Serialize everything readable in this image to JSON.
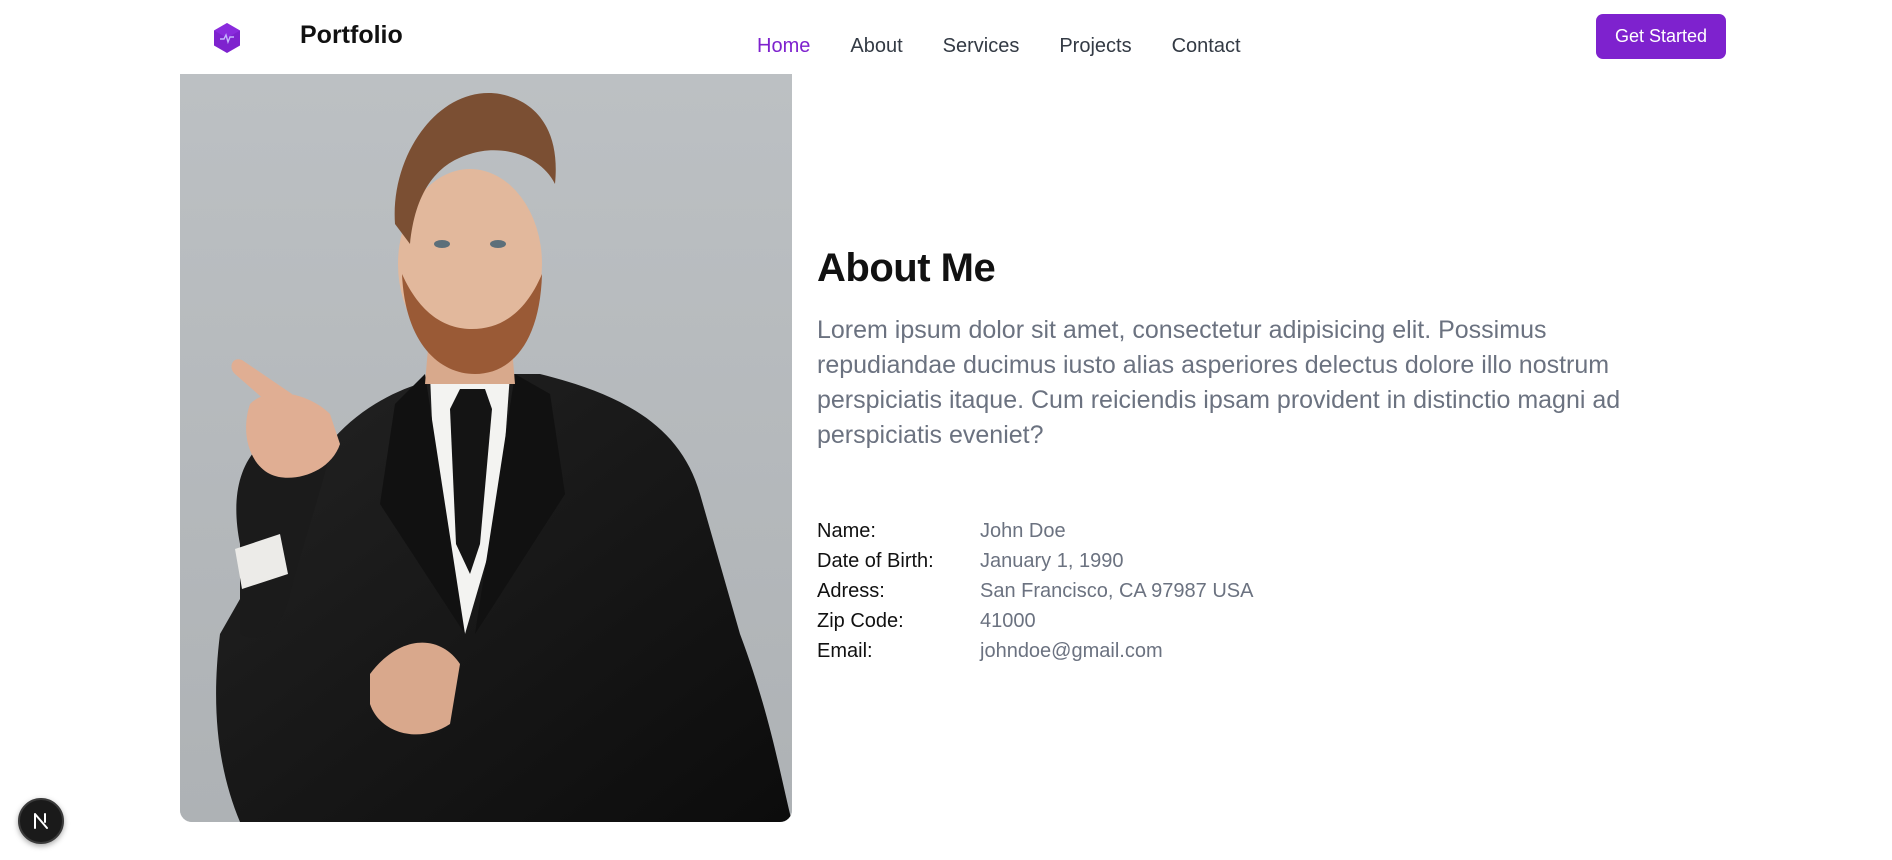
{
  "header": {
    "brand": "Portfolio",
    "nav": [
      {
        "label": "Home",
        "active": true
      },
      {
        "label": "About",
        "active": false
      },
      {
        "label": "Services",
        "active": false
      },
      {
        "label": "Projects",
        "active": false
      },
      {
        "label": "Contact",
        "active": false
      }
    ],
    "cta_label": "Get Started"
  },
  "about": {
    "title": "About Me",
    "text": "Lorem ipsum dolor sit amet, consectetur adipisicing elit. Possimus repudiandae ducimus iusto alias asperiores delectus dolore illo nostrum perspiciatis itaque. Cum reiciendis ipsam provident in distinctio magni ad perspiciatis eveniet?",
    "info": [
      {
        "label": "Name:",
        "value": "John Doe"
      },
      {
        "label": "Date of Birth:",
        "value": "January 1, 1990"
      },
      {
        "label": "Adress:",
        "value": "San Francisco, CA 97987 USA"
      },
      {
        "label": "Zip Code:",
        "value": "41000"
      },
      {
        "label": "Email:",
        "value": "johndoe@gmail.com"
      }
    ]
  },
  "colors": {
    "accent": "#7e22ce",
    "muted_text": "#6b7280",
    "photo_background": "#b8bcc0"
  },
  "icons": {
    "logo": "hexagon-logo-icon",
    "badge": "nextjs-icon"
  }
}
